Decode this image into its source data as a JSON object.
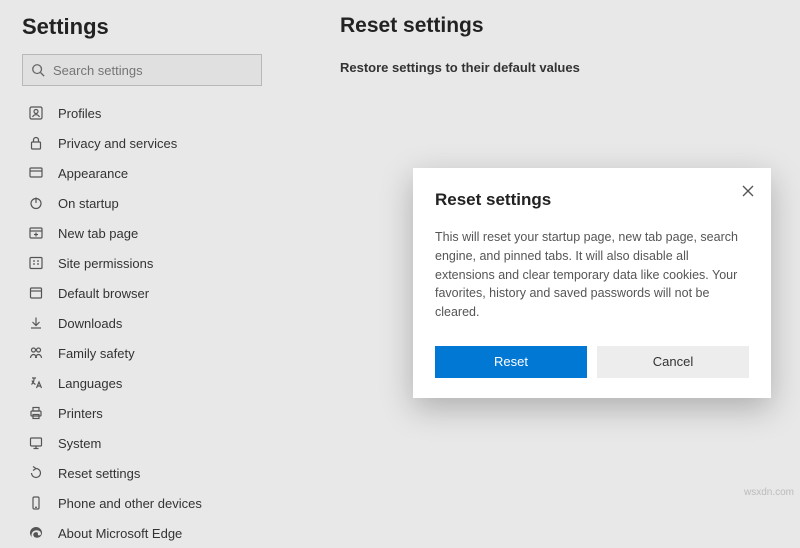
{
  "sidebar": {
    "heading": "Settings",
    "search_placeholder": "Search settings",
    "items": [
      {
        "label": "Profiles",
        "icon": "profile-icon"
      },
      {
        "label": "Privacy and services",
        "icon": "lock-icon"
      },
      {
        "label": "Appearance",
        "icon": "appearance-icon"
      },
      {
        "label": "On startup",
        "icon": "power-icon"
      },
      {
        "label": "New tab page",
        "icon": "newtab-icon"
      },
      {
        "label": "Site permissions",
        "icon": "permissions-icon"
      },
      {
        "label": "Default browser",
        "icon": "default-browser-icon"
      },
      {
        "label": "Downloads",
        "icon": "download-icon"
      },
      {
        "label": "Family safety",
        "icon": "family-icon"
      },
      {
        "label": "Languages",
        "icon": "languages-icon"
      },
      {
        "label": "Printers",
        "icon": "printer-icon"
      },
      {
        "label": "System",
        "icon": "system-icon"
      },
      {
        "label": "Reset settings",
        "icon": "reset-icon"
      },
      {
        "label": "Phone and other devices",
        "icon": "phone-icon"
      },
      {
        "label": "About Microsoft Edge",
        "icon": "edge-icon"
      }
    ]
  },
  "main": {
    "page_title": "Reset settings",
    "section_heading": "Restore settings to their default values"
  },
  "dialog": {
    "title": "Reset settings",
    "body": "This will reset your startup page, new tab page, search engine, and pinned tabs. It will also disable all extensions and clear temporary data like cookies. Your favorites, history and saved passwords will not be cleared.",
    "primary_label": "Reset",
    "secondary_label": "Cancel"
  },
  "watermark": "wsxdn.com"
}
